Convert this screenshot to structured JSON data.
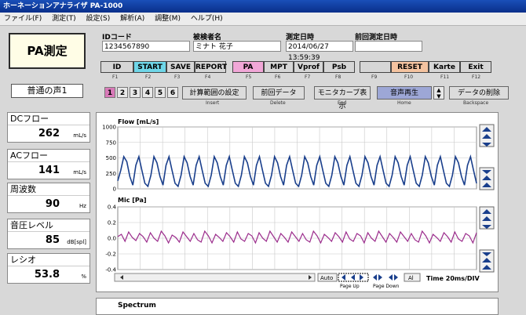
{
  "window": {
    "title": "ホーネーションアナライザ PA-1000"
  },
  "menu": [
    "ファイル(F)",
    "測定(T)",
    "設定(S)",
    "解析(A)",
    "調整(M)",
    "ヘルプ(H)"
  ],
  "left_panel": {
    "pa_button": "PA測定",
    "voice_label": "普通の声1",
    "measurements": [
      {
        "label": "DCフロー",
        "value": "262",
        "unit": "mL/s"
      },
      {
        "label": "ACフロー",
        "value": "141",
        "unit": "mL/s"
      },
      {
        "label": "周波数",
        "value": "90",
        "unit": "Hz"
      },
      {
        "label": "音圧レベル",
        "value": "85",
        "unit": "dB[spl]"
      },
      {
        "label": "レシオ",
        "value": "53.8",
        "unit": "%"
      }
    ]
  },
  "info": {
    "id_label": "IDコード",
    "id_value": "1234567890",
    "name_label": "被検者名",
    "name_value": "ミナト 花子",
    "datetime_label": "測定日時",
    "datetime_value": "2014/06/27 13:59:39",
    "prev_label": "前回測定日時",
    "prev_value": ""
  },
  "function_buttons": [
    {
      "label": "ID",
      "key": "F1",
      "color": "#cfcfcf"
    },
    {
      "label": "START",
      "key": "F2",
      "color": "#6fd6e8"
    },
    {
      "label": "SAVE",
      "key": "F3",
      "color": "#cfcfcf"
    },
    {
      "label": "REPORT",
      "key": "F4",
      "color": "#cfcfcf"
    },
    {
      "label": "PA",
      "key": "F5",
      "color": "#f1a7d7"
    },
    {
      "label": "MPT",
      "key": "F6",
      "color": "#cfcfcf"
    },
    {
      "label": "Vprof",
      "key": "F7",
      "color": "#cfcfcf"
    },
    {
      "label": "Psb",
      "key": "F8",
      "color": "#cfcfcf"
    },
    {
      "label": "",
      "key": "F9",
      "color": "#cfcfcf"
    },
    {
      "label": "RESET",
      "key": "F10",
      "color": "#f4c3a0"
    },
    {
      "label": "Karte",
      "key": "F11",
      "color": "#cfcfcf"
    },
    {
      "label": "Exit",
      "key": "F12",
      "color": "#cfcfcf"
    }
  ],
  "tabs": [
    "1",
    "2",
    "3",
    "4",
    "5",
    "6"
  ],
  "actions": [
    {
      "label": "計算範囲の設定",
      "sub": "Insert"
    },
    {
      "label": "前回データ",
      "sub": "Delete"
    },
    {
      "label": "モニタカーブ表示",
      "sub": "End"
    },
    {
      "label": "音声再生",
      "sub": "Home"
    },
    {
      "label": "データの削除",
      "sub": "Backspace"
    }
  ],
  "chart_data": [
    {
      "type": "line",
      "title": "Flow [mL/s]",
      "yticks": [
        0,
        250,
        500,
        750,
        1000
      ],
      "ylim": [
        0,
        1000
      ],
      "color": "#1a3f8c",
      "series": [
        {
          "values": [
            130,
            300,
            520,
            440,
            200,
            60,
            380,
            520,
            300,
            90,
            40,
            220,
            520,
            420,
            200,
            60,
            380,
            520,
            300,
            90,
            40,
            220,
            520,
            420,
            200,
            60,
            380,
            520,
            300,
            90,
            40,
            220,
            520,
            420,
            200,
            60,
            380,
            520,
            300,
            90,
            40,
            220,
            520,
            420,
            200,
            60,
            380,
            520,
            300,
            90,
            40,
            220,
            520,
            420,
            200,
            60,
            380,
            520,
            300,
            90,
            40,
            220,
            520,
            420,
            200,
            60,
            380,
            520,
            300,
            90,
            40,
            220,
            520,
            420,
            200,
            60,
            380,
            520,
            300,
            90,
            40,
            220,
            520,
            420,
            200,
            60,
            380,
            520,
            300,
            90,
            40,
            220,
            520,
            420,
            200,
            60,
            380,
            520,
            300,
            90,
            40,
            220,
            520,
            420,
            200,
            60,
            380,
            520,
            300,
            90,
            40,
            220,
            520,
            420,
            200,
            60,
            380,
            520,
            300,
            90
          ]
        }
      ]
    },
    {
      "type": "line",
      "title": "Mic [Pa]",
      "yticks": [
        0.4,
        0.2,
        0.0,
        -0.2,
        -0.4
      ],
      "ylim": [
        -0.4,
        0.4
      ],
      "color": "#9b2c8c",
      "series": [
        {
          "values": [
            0.02,
            0.05,
            -0.04,
            0.08,
            0.01,
            -0.03,
            0.06,
            0.02,
            -0.05,
            0.07,
            0.0,
            -0.04,
            0.09,
            0.03,
            -0.06,
            0.04,
            0.01,
            -0.05,
            0.08,
            0.02,
            -0.04,
            0.06,
            -0.02,
            -0.05,
            0.09,
            0.03,
            -0.06,
            0.05,
            0.01,
            -0.04,
            0.07,
            0.02,
            -0.05,
            0.08,
            -0.01,
            -0.04,
            0.06,
            0.03,
            -0.06,
            0.07,
            0.0,
            -0.04,
            0.09,
            0.02,
            -0.05,
            0.06,
            0.01,
            -0.05,
            0.08,
            0.02,
            -0.04,
            0.06,
            -0.02,
            -0.05,
            0.09,
            0.03,
            -0.06,
            0.05,
            0.01,
            -0.04,
            0.07,
            0.02,
            -0.05,
            0.08,
            -0.01,
            -0.04,
            0.06,
            0.03,
            -0.06,
            0.07,
            0.0,
            -0.04,
            0.09,
            0.02,
            -0.05,
            0.06,
            0.01,
            -0.05,
            0.08,
            0.02,
            -0.04,
            0.06,
            -0.02,
            -0.05,
            0.09,
            0.03,
            -0.06,
            0.05,
            0.01,
            -0.04,
            0.07,
            0.02,
            -0.05,
            0.08,
            -0.01,
            -0.04,
            0.06,
            0.03,
            -0.06,
            0.07
          ]
        }
      ]
    }
  ],
  "chart_controls": {
    "auto": "Auto",
    "page_up": "Page Up",
    "page_down": "Page Down",
    "al": "Al",
    "time_label": "Time 20ms/DIV"
  },
  "spectrum": {
    "title": "Spectrum"
  }
}
